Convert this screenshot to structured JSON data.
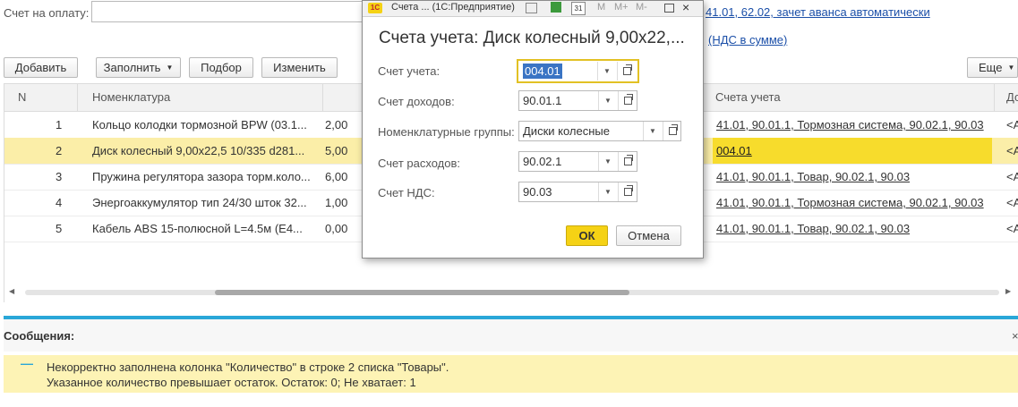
{
  "top": {
    "invoice_label": "Счет на оплату:",
    "right_link1": "41.01, 62.02, зачет аванса автоматически",
    "right_link2": "(НДС в сумме)"
  },
  "toolbar": {
    "add": "Добавить",
    "fill": "Заполнить",
    "select": "Подбор",
    "change": "Изменить",
    "more": "Еще"
  },
  "table": {
    "columns": {
      "n": "N",
      "nomenclature": "Номенклатура",
      "accounts": "Счета учета",
      "extra": "До"
    },
    "rows": [
      {
        "n": "1",
        "name": "Кольцо колодки тормозной BPW (03.1...",
        "qty": "2,00",
        "accounts": "41.01, 90.01.1, Тормозная система, 90.02.1, 90.03",
        "extra": "<А"
      },
      {
        "n": "2",
        "name": "Диск колесный  9,00x22,5 10/335 d281...",
        "qty": "5,00",
        "accounts": "004.01",
        "extra": "<А"
      },
      {
        "n": "3",
        "name": "Пружина регулятора зазора торм.коло...",
        "qty": "6,00",
        "accounts": "41.01, 90.01.1, Товар, 90.02.1, 90.03",
        "extra": "<А"
      },
      {
        "n": "4",
        "name": "Энергоаккумулятор тип 24/30 шток 32...",
        "qty": "1,00",
        "accounts": "41.01, 90.01.1, Тормозная система, 90.02.1, 90.03",
        "extra": "<А"
      },
      {
        "n": "5",
        "name": "Кабель ABS 15-полюсной L=4.5м (Е4...",
        "qty": "0,00",
        "accounts": "41.01, 90.01.1, Товар, 90.02.1, 90.03",
        "extra": "<А"
      }
    ]
  },
  "messages": {
    "title": "Сообщения:",
    "line1": "Некорректно заполнена колонка \"Количество\" в строке 2 списка \"Товары\".",
    "line2": "Указанное количество превышает остаток. Остаток: 0; Не хватает: 1"
  },
  "dialog": {
    "window_title": "Счета ...  (1С:Предприятие)",
    "app_badge": "1С",
    "heading": "Счета учета: Диск колесный  9,00x22,...",
    "fields": {
      "account_label": "Счет учета:",
      "account_value": "004.01",
      "income_label": "Счет доходов:",
      "income_value": "90.01.1",
      "group_label": "Номенклатурные группы:",
      "group_value": "Диски колесные",
      "expense_label": "Счет расходов:",
      "expense_value": "90.02.1",
      "vat_label": "Счет НДС:",
      "vat_value": "90.03"
    },
    "ok": "ОК",
    "cancel": "Отмена",
    "toolbar_icons": {
      "calendar_day": "31",
      "mem": "M",
      "mem_plus": "M+",
      "mem_minus": "M-"
    }
  },
  "colors": {
    "selected_row": "#fbeea8",
    "selected_cell": "#f7dc2c",
    "ok_button": "#f5d215",
    "separator": "#2aa7d8",
    "message_bg": "#fdf3b5",
    "link": "#1b4fa8"
  }
}
